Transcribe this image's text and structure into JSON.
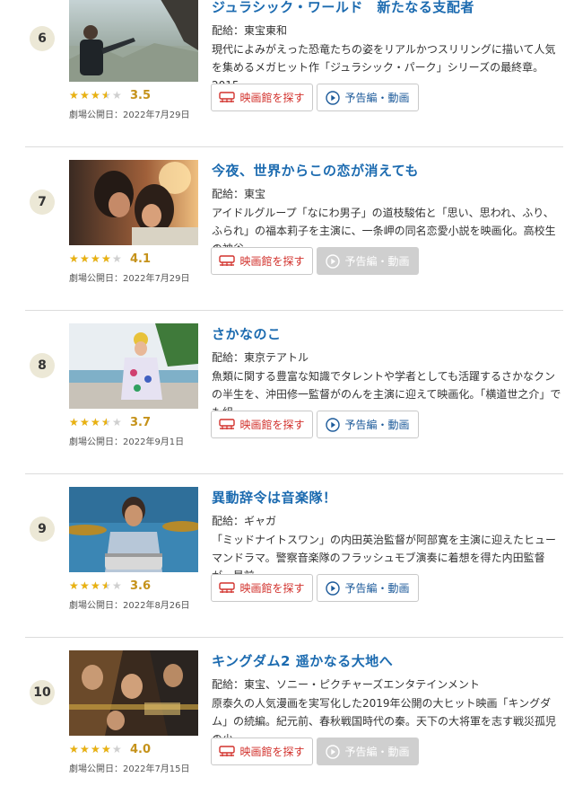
{
  "colors": {
    "title": "#1c6bb0",
    "star": "#e9b10f",
    "score": "#c5921a",
    "theater_button_text": "#d2322d",
    "trailer_button_text": "#1c5a9a",
    "trailer_disabled_bg": "#cfcfcf",
    "rank_badge_bg": "#ece8d6"
  },
  "items": [
    {
      "rank": "6",
      "title": "ジュラシック・ワールド　新たなる支配者",
      "distributor": "配給：東宝東和",
      "synopsis": "現代によみがえった恐竜たちの姿をリアルかつスリリングに描いて人気を集めるメガヒット作「ジュラシック・パーク」シリーズの最終章。2015…",
      "rating": 3.5,
      "score_label": "3.5",
      "release": "劇場公開日：2022年7月29日",
      "theater_label": "映画館を探す",
      "trailer_label": "予告編・動画",
      "trailer_enabled": true,
      "poster_icon": "jurassic-world-still"
    },
    {
      "rank": "7",
      "title": "今夜、世界からこの恋が消えても",
      "distributor": "配給：東宝",
      "synopsis": "アイドルグループ「なにわ男子」の道枝駿佑と「思い、思われ、ふり、ふられ」の福本莉子を主演に、一条岬の同名恋愛小説を映画化。高校生の神谷…",
      "rating": 4.1,
      "score_label": "4.1",
      "release": "劇場公開日：2022年7月29日",
      "theater_label": "映画館を探す",
      "trailer_label": "予告編・動画",
      "trailer_enabled": false,
      "poster_icon": "couple-still"
    },
    {
      "rank": "8",
      "title": "さかなのこ",
      "distributor": "配給：東京テアトル",
      "synopsis": "魚類に関する豊富な知識でタレントや学者としても活躍するさかなクンの半生を、沖田修一監督がのんを主演に迎えて映画化。「横道世之介」でも組…",
      "rating": 3.7,
      "score_label": "3.7",
      "release": "劇場公開日：2022年9月1日",
      "theater_label": "映画館を探す",
      "trailer_label": "予告編・動画",
      "trailer_enabled": true,
      "poster_icon": "beach-still"
    },
    {
      "rank": "9",
      "title": "異動辞令は音楽隊！",
      "distributor": "配給：ギャガ",
      "synopsis": "「ミッドナイトスワン」の内田英治監督が阿部寛を主演に迎えたヒューマンドラマ。警察音楽隊のフラッシュモブ演奏に着想を得た内田監督が、最前…",
      "rating": 3.6,
      "score_label": "3.6",
      "release": "劇場公開日：2022年8月26日",
      "theater_label": "映画館を探す",
      "trailer_label": "予告編・動画",
      "trailer_enabled": true,
      "poster_icon": "drummer-still"
    },
    {
      "rank": "10",
      "title": "キングダム2 遥かなる大地へ",
      "distributor": "配給：東宝、ソニー・ピクチャーズエンタテインメント",
      "synopsis": "原泰久の人気漫画を実写化した2019年公開の大ヒット映画「キングダム」の続編。紀元前、春秋戦国時代の秦。天下の大将軍を志す戦災孤児の少…",
      "rating": 4.0,
      "score_label": "4.0",
      "release": "劇場公開日：2022年7月15日",
      "theater_label": "映画館を探す",
      "trailer_label": "予告編・動画",
      "trailer_enabled": false,
      "poster_icon": "kingdom-poster"
    }
  ]
}
